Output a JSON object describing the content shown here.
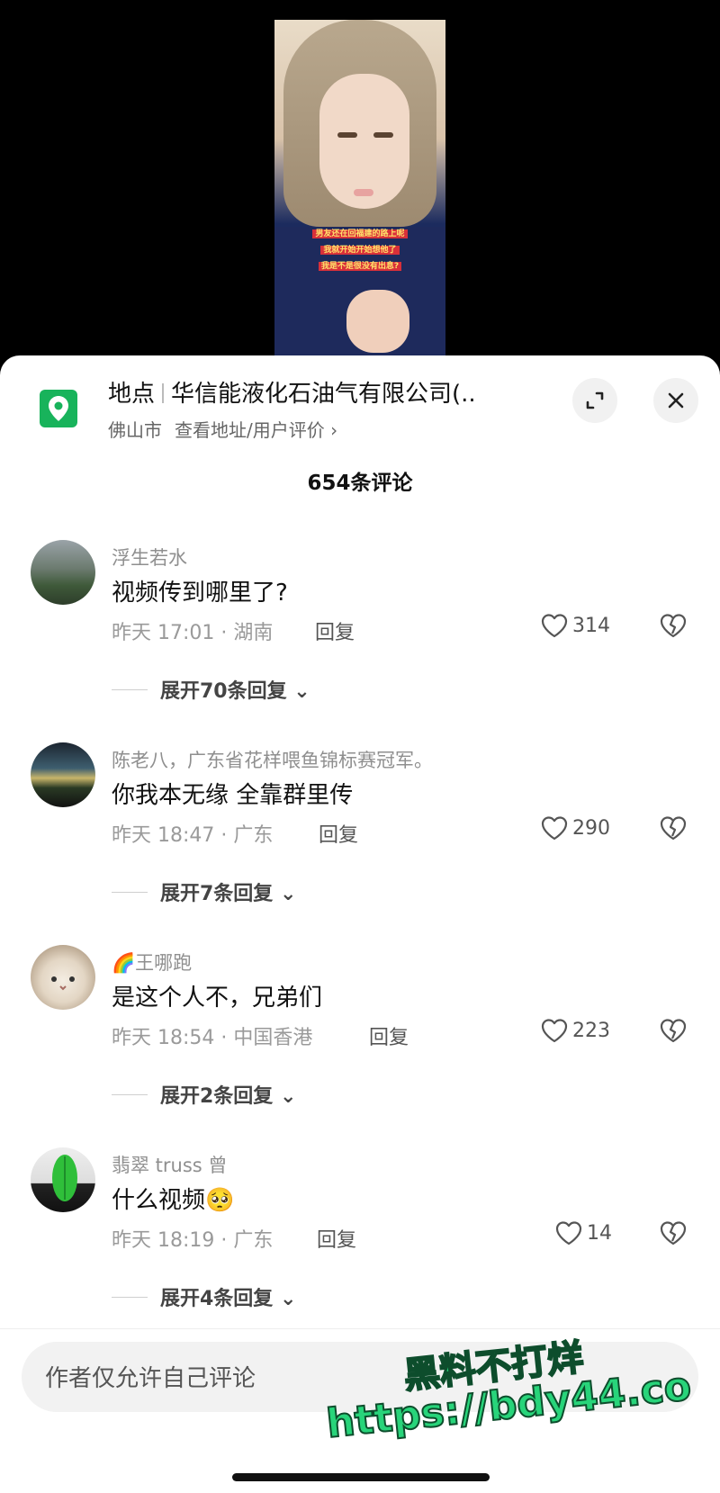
{
  "video": {
    "caption_lines": [
      "男友还在回福建的路上呢",
      "我就开始开始想他了",
      "我是不是很没有出息?"
    ]
  },
  "location": {
    "label": "地点",
    "name": "华信能液化石油气有限公司(..",
    "city": "佛山市",
    "link": "查看地址/用户评价 ›"
  },
  "comment_count": "654条评论",
  "comments": [
    {
      "user": "浮生若水",
      "text": "视频传到哪里了?",
      "meta": "昨天 17:01 · 湖南",
      "reply": "回复",
      "likes": "314",
      "expand": "展开70条回复 ⌄"
    },
    {
      "user": "陈老八，广东省花样喂鱼锦标赛冠军。",
      "text": "你我本无缘 全靠群里传",
      "meta": "昨天 18:47 · 广东",
      "reply": "回复",
      "likes": "290",
      "expand": "展开7条回复 ⌄"
    },
    {
      "user": "王哪跑",
      "user_prefix": "🌈",
      "text": "是这个人不，兄弟们",
      "meta": "昨天 18:54 · 中国香港",
      "reply": "回复",
      "likes": "223",
      "expand": "展开2条回复 ⌄"
    },
    {
      "user": "翡翠 truss 曾",
      "text": "什么视频",
      "text_emoji": "🥺",
      "meta": "昨天 18:19 · 广东",
      "reply": "回复",
      "likes": "14",
      "expand": "展开4条回复 ⌄"
    }
  ],
  "input": {
    "placeholder": "作者仅允许自己评论"
  },
  "watermark": {
    "line1": "黑料不打烊",
    "line2": "https://bdy44.co"
  },
  "colors": {
    "accent": "#18b35b",
    "watermark": "#28d47a"
  },
  "icons": [
    "location-pin-icon",
    "expand-icon",
    "close-icon",
    "heart-icon",
    "broken-heart-icon",
    "chevron-down-icon"
  ]
}
